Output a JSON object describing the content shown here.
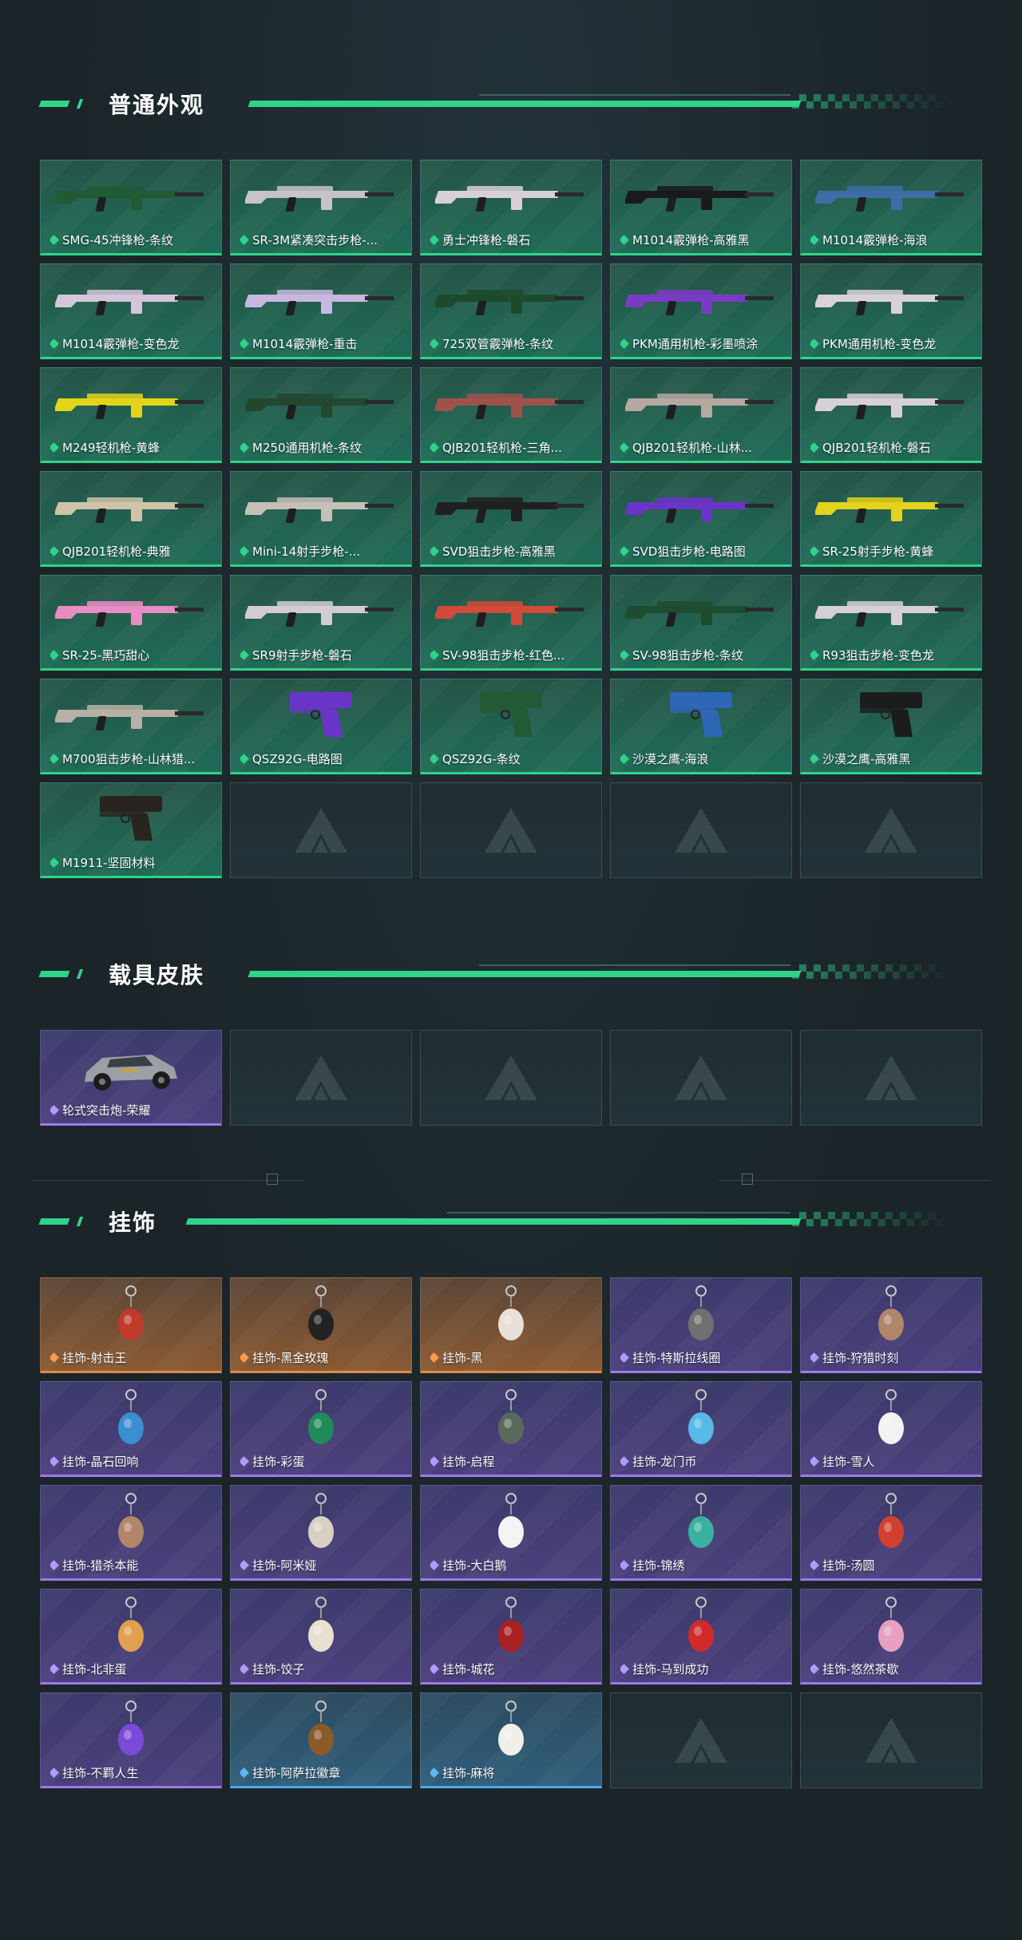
{
  "sections": {
    "weapons": {
      "title": "普通外观",
      "items": [
        {
          "label": "SMG-45冲锋枪-条纹",
          "rarity": "green",
          "kind": "weapon",
          "color": "#1f5a35"
        },
        {
          "label": "SR-3M紧凑突击步枪-...",
          "rarity": "green",
          "kind": "weapon",
          "color": "#c8c3c8"
        },
        {
          "label": "勇士冲锋枪-磐石",
          "rarity": "green",
          "kind": "weapon",
          "color": "#d8d0d8"
        },
        {
          "label": "M1014霰弹枪-高雅黑",
          "rarity": "green",
          "kind": "weapon",
          "color": "#1a1a1a"
        },
        {
          "label": "M1014霰弹枪-海浪",
          "rarity": "green",
          "kind": "weapon",
          "color": "#3c6ea5"
        },
        {
          "label": "M1014霰弹枪-变色龙",
          "rarity": "green",
          "kind": "weapon",
          "color": "#d5c6d9"
        },
        {
          "label": "M1014霰弹枪-重击",
          "rarity": "green",
          "kind": "weapon",
          "color": "#c8b8e0"
        },
        {
          "label": "725双管霰弹枪-条纹",
          "rarity": "green",
          "kind": "weapon",
          "color": "#1d4a2c"
        },
        {
          "label": "PKM通用机枪-彩墨喷涂",
          "rarity": "green",
          "kind": "weapon",
          "color": "#7a3bc4"
        },
        {
          "label": "PKM通用机枪-变色龙",
          "rarity": "green",
          "kind": "weapon",
          "color": "#d9d2da"
        },
        {
          "label": "M249轻机枪-黄蜂",
          "rarity": "green",
          "kind": "weapon",
          "color": "#e3d41b"
        },
        {
          "label": "M250通用机枪-条纹",
          "rarity": "green",
          "kind": "weapon",
          "color": "#23472e"
        },
        {
          "label": "QJB201轻机枪-三角...",
          "rarity": "green",
          "kind": "weapon",
          "color": "#a0524a"
        },
        {
          "label": "QJB201轻机枪-山林...",
          "rarity": "green",
          "kind": "weapon",
          "color": "#b5a8a0"
        },
        {
          "label": "QJB201轻机枪-磐石",
          "rarity": "green",
          "kind": "weapon",
          "color": "#d8d0d8"
        },
        {
          "label": "QJB201轻机枪-典雅",
          "rarity": "green",
          "kind": "weapon",
          "color": "#cfc3a8"
        },
        {
          "label": "Mini-14射手步枪-...",
          "rarity": "green",
          "kind": "weapon",
          "color": "#c5c0b8"
        },
        {
          "label": "SVD狙击步枪-高雅黑",
          "rarity": "green",
          "kind": "weapon",
          "color": "#202020"
        },
        {
          "label": "SVD狙击步枪-电路图",
          "rarity": "green",
          "kind": "weapon",
          "color": "#6a34c8"
        },
        {
          "label": "SR-25射手步枪-黄蜂",
          "rarity": "green",
          "kind": "weapon",
          "color": "#e4d21c"
        },
        {
          "label": "SR-25-黑巧甜心",
          "rarity": "green",
          "kind": "weapon",
          "color": "#ea8cc4"
        },
        {
          "label": "SR9射手步枪-磐石",
          "rarity": "green",
          "kind": "weapon",
          "color": "#d4ccd4"
        },
        {
          "label": "SV-98狙击步枪-红色...",
          "rarity": "green",
          "kind": "weapon",
          "color": "#d24a3a"
        },
        {
          "label": "SV-98狙击步枪-条纹",
          "rarity": "green",
          "kind": "weapon",
          "color": "#1e4c2e"
        },
        {
          "label": "R93狙击步枪-变色龙",
          "rarity": "green",
          "kind": "weapon",
          "color": "#d6cfd8"
        },
        {
          "label": "M700狙击步枪-山林猎...",
          "rarity": "green",
          "kind": "weapon",
          "color": "#b8b0a5"
        },
        {
          "label": "QSZ92G-电路图",
          "rarity": "green",
          "kind": "pistol",
          "color": "#6a34c8"
        },
        {
          "label": "QSZ92G-条纹",
          "rarity": "green",
          "kind": "pistol",
          "color": "#235a36"
        },
        {
          "label": "沙漠之鹰-海浪",
          "rarity": "green",
          "kind": "pistol",
          "color": "#2e66b8"
        },
        {
          "label": "沙漠之鹰-高雅黑",
          "rarity": "green",
          "kind": "pistol",
          "color": "#1c1c1c"
        },
        {
          "label": "M1911-坚固材料",
          "rarity": "green",
          "kind": "pistol",
          "color": "#2a2420"
        },
        {
          "label": "",
          "rarity": "empty"
        },
        {
          "label": "",
          "rarity": "empty"
        },
        {
          "label": "",
          "rarity": "empty"
        },
        {
          "label": "",
          "rarity": "empty"
        }
      ]
    },
    "vehicles": {
      "title": "载具皮肤",
      "items": [
        {
          "label": "轮式突击炮-荣耀",
          "rarity": "purple",
          "kind": "car",
          "color": "#9aa0a3"
        },
        {
          "label": "",
          "rarity": "empty"
        },
        {
          "label": "",
          "rarity": "empty"
        },
        {
          "label": "",
          "rarity": "empty"
        },
        {
          "label": "",
          "rarity": "empty"
        }
      ]
    },
    "charms": {
      "title": "挂饰",
      "items": [
        {
          "label": "挂饰-射击王",
          "rarity": "orange",
          "kind": "charm",
          "color": "#c0392b"
        },
        {
          "label": "挂饰-黑金玫瑰",
          "rarity": "orange",
          "kind": "charm",
          "color": "#222222"
        },
        {
          "label": "挂饰-黑",
          "rarity": "orange",
          "kind": "charm",
          "color": "#e8e0d8"
        },
        {
          "label": "挂饰-特斯拉线圈",
          "rarity": "purple",
          "kind": "charm",
          "color": "#707070"
        },
        {
          "label": "挂饰-狩猎时刻",
          "rarity": "purple",
          "kind": "charm",
          "color": "#b0856a"
        },
        {
          "label": "挂饰-晶石回响",
          "rarity": "purple",
          "kind": "charm",
          "color": "#3a8fd0"
        },
        {
          "label": "挂饰-彩蛋",
          "rarity": "purple",
          "kind": "charm",
          "color": "#1f8a5a"
        },
        {
          "label": "挂饰-启程",
          "rarity": "purple",
          "kind": "charm",
          "color": "#5a6a5a"
        },
        {
          "label": "挂饰-龙门币",
          "rarity": "purple",
          "kind": "charm",
          "color": "#58b8e8"
        },
        {
          "label": "挂饰-雪人",
          "rarity": "purple",
          "kind": "charm",
          "color": "#f2f2f2"
        },
        {
          "label": "挂饰-猎杀本能",
          "rarity": "purple",
          "kind": "charm",
          "color": "#b0856a"
        },
        {
          "label": "挂饰-阿米娅",
          "rarity": "purple",
          "kind": "charm",
          "color": "#d8d0c0"
        },
        {
          "label": "挂饰-大白鹅",
          "rarity": "purple",
          "kind": "charm",
          "color": "#f4f4f4"
        },
        {
          "label": "挂饰-锦绣",
          "rarity": "purple",
          "kind": "charm",
          "color": "#3ab0a0"
        },
        {
          "label": "挂饰-汤圆",
          "rarity": "purple",
          "kind": "charm",
          "color": "#d04030"
        },
        {
          "label": "挂饰-北非蛋",
          "rarity": "purple",
          "kind": "charm",
          "color": "#e0a050"
        },
        {
          "label": "挂饰-饺子",
          "rarity": "purple",
          "kind": "charm",
          "color": "#e8e0d0"
        },
        {
          "label": "挂饰-城花",
          "rarity": "purple",
          "kind": "charm",
          "color": "#a82020"
        },
        {
          "label": "挂饰-马到成功",
          "rarity": "purple",
          "kind": "charm",
          "color": "#d02a2a"
        },
        {
          "label": "挂饰-悠然茶歇",
          "rarity": "purple",
          "kind": "charm",
          "color": "#e8a0c0"
        },
        {
          "label": "挂饰-不羁人生",
          "rarity": "purple",
          "kind": "charm",
          "color": "#7a4ad8"
        },
        {
          "label": "挂饰-阿萨拉徽章",
          "rarity": "blue",
          "kind": "charm",
          "color": "#8a5a2a"
        },
        {
          "label": "挂饰-麻将",
          "rarity": "blue",
          "kind": "charm",
          "color": "#f0f0e8"
        },
        {
          "label": "",
          "rarity": "empty"
        },
        {
          "label": "",
          "rarity": "empty"
        }
      ]
    }
  }
}
